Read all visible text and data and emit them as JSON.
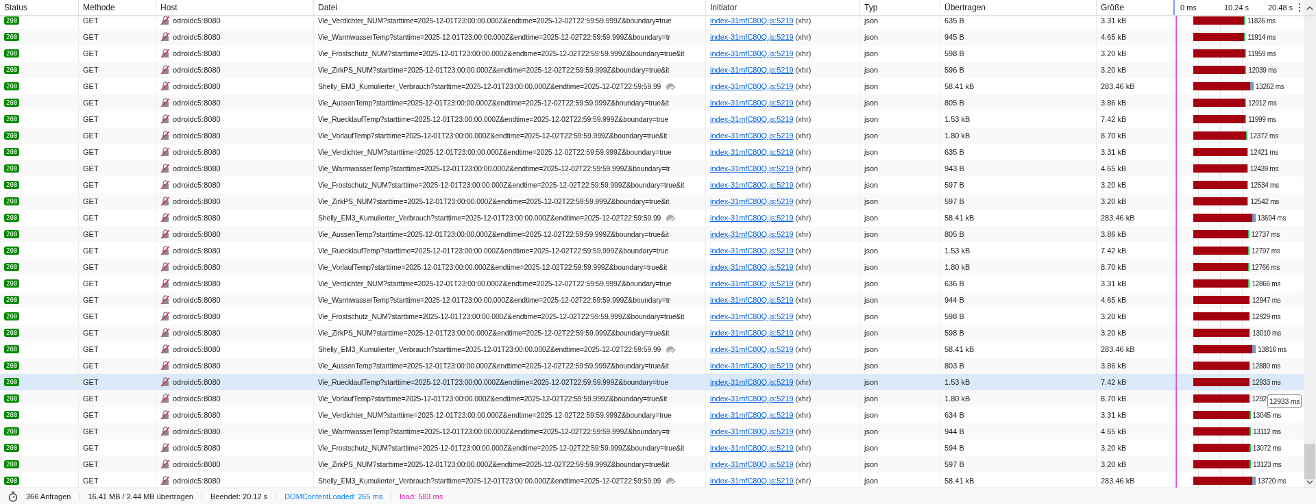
{
  "columns": [
    "Status",
    "Methode",
    "Host",
    "Datei",
    "Initiator",
    "Typ",
    "Übertragen",
    "Größe"
  ],
  "waterfall_ticks": [
    "0 ms",
    "10.24 s",
    "20.48 s"
  ],
  "rows": [
    {
      "status": "200",
      "method": "GET",
      "host": "odroidc5:8080",
      "file": "Vie_Verdichter_NUM?starttime=2025-12-01T23:00:00.000Z&endtime=2025-12-02T22:59:59.999Z&boundary=true",
      "slow": false,
      "initiator": "index-31mfC80Q.js:5219",
      "cause": "(xhr)",
      "type": "json",
      "transferred": "635 B",
      "size": "3.31 kB",
      "time": "11826 ms",
      "selected": false
    },
    {
      "status": "200",
      "method": "GET",
      "host": "odroidc5:8080",
      "file": "Vie_WarmwasserTemp?starttime=2025-12-01T23:00:00.000Z&endtime=2025-12-02T22:59:59.999Z&boundary=tr",
      "slow": false,
      "initiator": "index-31mfC80Q.js:5219",
      "cause": "(xhr)",
      "type": "json",
      "transferred": "945 B",
      "size": "4.65 kB",
      "time": "11914 ms",
      "selected": false
    },
    {
      "status": "200",
      "method": "GET",
      "host": "odroidc5:8080",
      "file": "Vie_Frostschutz_NUM?starttime=2025-12-01T23:00:00.000Z&endtime=2025-12-02T22:59:59.999Z&boundary=true&it",
      "slow": false,
      "initiator": "index-31mfC80Q.js:5219",
      "cause": "(xhr)",
      "type": "json",
      "transferred": "598 B",
      "size": "3.20 kB",
      "time": "11959 ms",
      "selected": false
    },
    {
      "status": "200",
      "method": "GET",
      "host": "odroidc5:8080",
      "file": "Vie_ZirkPS_NUM?starttime=2025-12-01T23:00:00.000Z&endtime=2025-12-02T22:59:59.999Z&boundary=true&it",
      "slow": false,
      "initiator": "index-31mfC80Q.js:5219",
      "cause": "(xhr)",
      "type": "json",
      "transferred": "596 B",
      "size": "3.20 kB",
      "time": "12039 ms",
      "selected": false
    },
    {
      "status": "200",
      "method": "GET",
      "host": "odroidc5:8080",
      "file": "Shelly_EM3_Kumulierter_Verbrauch?starttime=2025-12-01T23:00:00.000Z&endtime=2025-12-02T22:59:59.99",
      "slow": true,
      "initiator": "index-31mfC80Q.js:5219",
      "cause": "(xhr)",
      "type": "json",
      "transferred": "58.41 kB",
      "size": "283.46 kB",
      "time": "13262 ms",
      "selected": false
    },
    {
      "status": "200",
      "method": "GET",
      "host": "odroidc5:8080",
      "file": "Vie_AussenTemp?starttime=2025-12-01T23:00:00.000Z&endtime=2025-12-02T22:59:59.999Z&boundary=true&it",
      "slow": false,
      "initiator": "index-31mfC80Q.js:5219",
      "cause": "(xhr)",
      "type": "json",
      "transferred": "805 B",
      "size": "3.86 kB",
      "time": "12012 ms",
      "selected": false
    },
    {
      "status": "200",
      "method": "GET",
      "host": "odroidc5:8080",
      "file": "Vie_RuecklaufTemp?starttime=2025-12-01T23:00:00.000Z&endtime=2025-12-02T22:59:59.999Z&boundary=true",
      "slow": false,
      "initiator": "index-31mfC80Q.js:5219",
      "cause": "(xhr)",
      "type": "json",
      "transferred": "1.53 kB",
      "size": "7.42 kB",
      "time": "11999 ms",
      "selected": false
    },
    {
      "status": "200",
      "method": "GET",
      "host": "odroidc5:8080",
      "file": "Vie_VorlaufTemp?starttime=2025-12-01T23:00:00.000Z&endtime=2025-12-02T22:59:59.999Z&boundary=true&it",
      "slow": false,
      "initiator": "index-31mfC80Q.js:5219",
      "cause": "(xhr)",
      "type": "json",
      "transferred": "1.80 kB",
      "size": "8.70 kB",
      "time": "12372 ms",
      "selected": false
    },
    {
      "status": "200",
      "method": "GET",
      "host": "odroidc5:8080",
      "file": "Vie_Verdichter_NUM?starttime=2025-12-01T23:00:00.000Z&endtime=2025-12-02T22:59:59.999Z&boundary=true",
      "slow": false,
      "initiator": "index-31mfC80Q.js:5219",
      "cause": "(xhr)",
      "type": "json",
      "transferred": "635 B",
      "size": "3.31 kB",
      "time": "12421 ms",
      "selected": false
    },
    {
      "status": "200",
      "method": "GET",
      "host": "odroidc5:8080",
      "file": "Vie_WarmwasserTemp?starttime=2025-12-01T23:00:00.000Z&endtime=2025-12-02T22:59:59.999Z&boundary=tr",
      "slow": false,
      "initiator": "index-31mfC80Q.js:5219",
      "cause": "(xhr)",
      "type": "json",
      "transferred": "943 B",
      "size": "4.65 kB",
      "time": "12439 ms",
      "selected": false
    },
    {
      "status": "200",
      "method": "GET",
      "host": "odroidc5:8080",
      "file": "Vie_Frostschutz_NUM?starttime=2025-12-01T23:00:00.000Z&endtime=2025-12-02T22:59:59.999Z&boundary=true&it",
      "slow": false,
      "initiator": "index-31mfC80Q.js:5219",
      "cause": "(xhr)",
      "type": "json",
      "transferred": "597 B",
      "size": "3.20 kB",
      "time": "12534 ms",
      "selected": false
    },
    {
      "status": "200",
      "method": "GET",
      "host": "odroidc5:8080",
      "file": "Vie_ZirkPS_NUM?starttime=2025-12-01T23:00:00.000Z&endtime=2025-12-02T22:59:59.999Z&boundary=true&it",
      "slow": false,
      "initiator": "index-31mfC80Q.js:5219",
      "cause": "(xhr)",
      "type": "json",
      "transferred": "597 B",
      "size": "3.20 kB",
      "time": "12542 ms",
      "selected": false
    },
    {
      "status": "200",
      "method": "GET",
      "host": "odroidc5:8080",
      "file": "Shelly_EM3_Kumulierter_Verbrauch?starttime=2025-12-01T23:00:00.000Z&endtime=2025-12-02T22:59:59.99",
      "slow": true,
      "initiator": "index-31mfC80Q.js:5219",
      "cause": "(xhr)",
      "type": "json",
      "transferred": "58.41 kB",
      "size": "283.46 kB",
      "time": "13694 ms",
      "selected": false
    },
    {
      "status": "200",
      "method": "GET",
      "host": "odroidc5:8080",
      "file": "Vie_AussenTemp?starttime=2025-12-01T23:00:00.000Z&endtime=2025-12-02T22:59:59.999Z&boundary=true&it",
      "slow": false,
      "initiator": "index-31mfC80Q.js:5219",
      "cause": "(xhr)",
      "type": "json",
      "transferred": "805 B",
      "size": "3.86 kB",
      "time": "12737 ms",
      "selected": false
    },
    {
      "status": "200",
      "method": "GET",
      "host": "odroidc5:8080",
      "file": "Vie_RuecklaufTemp?starttime=2025-12-01T23:00:00.000Z&endtime=2025-12-02T22:59:59.999Z&boundary=true",
      "slow": false,
      "initiator": "index-31mfC80Q.js:5219",
      "cause": "(xhr)",
      "type": "json",
      "transferred": "1.53 kB",
      "size": "7.42 kB",
      "time": "12797 ms",
      "selected": false
    },
    {
      "status": "200",
      "method": "GET",
      "host": "odroidc5:8080",
      "file": "Vie_VorlaufTemp?starttime=2025-12-01T23:00:00.000Z&endtime=2025-12-02T22:59:59.999Z&boundary=true&it",
      "slow": false,
      "initiator": "index-31mfC80Q.js:5219",
      "cause": "(xhr)",
      "type": "json",
      "transferred": "1.80 kB",
      "size": "8.70 kB",
      "time": "12766 ms",
      "selected": false
    },
    {
      "status": "200",
      "method": "GET",
      "host": "odroidc5:8080",
      "file": "Vie_Verdichter_NUM?starttime=2025-12-01T23:00:00.000Z&endtime=2025-12-02T22:59:59.999Z&boundary=true",
      "slow": false,
      "initiator": "index-31mfC80Q.js:5219",
      "cause": "(xhr)",
      "type": "json",
      "transferred": "636 B",
      "size": "3.31 kB",
      "time": "12866 ms",
      "selected": false
    },
    {
      "status": "200",
      "method": "GET",
      "host": "odroidc5:8080",
      "file": "Vie_WarmwasserTemp?starttime=2025-12-01T23:00:00.000Z&endtime=2025-12-02T22:59:59.999Z&boundary=tr",
      "slow": false,
      "initiator": "index-31mfC80Q.js:5219",
      "cause": "(xhr)",
      "type": "json",
      "transferred": "944 B",
      "size": "4.65 kB",
      "time": "12947 ms",
      "selected": false
    },
    {
      "status": "200",
      "method": "GET",
      "host": "odroidc5:8080",
      "file": "Vie_Frostschutz_NUM?starttime=2025-12-01T23:00:00.000Z&endtime=2025-12-02T22:59:59.999Z&boundary=true&it",
      "slow": false,
      "initiator": "index-31mfC80Q.js:5219",
      "cause": "(xhr)",
      "type": "json",
      "transferred": "598 B",
      "size": "3.20 kB",
      "time": "12929 ms",
      "selected": false
    },
    {
      "status": "200",
      "method": "GET",
      "host": "odroidc5:8080",
      "file": "Vie_ZirkPS_NUM?starttime=2025-12-01T23:00:00.000Z&endtime=2025-12-02T22:59:59.999Z&boundary=true&it",
      "slow": false,
      "initiator": "index-31mfC80Q.js:5219",
      "cause": "(xhr)",
      "type": "json",
      "transferred": "598 B",
      "size": "3.20 kB",
      "time": "13010 ms",
      "selected": false
    },
    {
      "status": "200",
      "method": "GET",
      "host": "odroidc5:8080",
      "file": "Shelly_EM3_Kumulierter_Verbrauch?starttime=2025-12-01T23:00:00.000Z&endtime=2025-12-02T22:59:59.99",
      "slow": true,
      "initiator": "index-31mfC80Q.js:5219",
      "cause": "(xhr)",
      "type": "json",
      "transferred": "58.41 kB",
      "size": "283.46 kB",
      "time": "13816 ms",
      "selected": false
    },
    {
      "status": "200",
      "method": "GET",
      "host": "odroidc5:8080",
      "file": "Vie_AussenTemp?starttime=2025-12-01T23:00:00.000Z&endtime=2025-12-02T22:59:59.999Z&boundary=true&it",
      "slow": false,
      "initiator": "index-31mfC80Q.js:5219",
      "cause": "(xhr)",
      "type": "json",
      "transferred": "803 B",
      "size": "3.86 kB",
      "time": "12880 ms",
      "selected": false
    },
    {
      "status": "200",
      "method": "GET",
      "host": "odroidc5:8080",
      "file": "Vie_RuecklaufTemp?starttime=2025-12-01T23:00:00.000Z&endtime=2025-12-02T22:59:59.999Z&boundary=true",
      "slow": false,
      "initiator": "index-31mfC80Q.js:5219",
      "cause": "(xhr)",
      "type": "json",
      "transferred": "1.53 kB",
      "size": "7.42 kB",
      "time": "12933 ms",
      "selected": true
    },
    {
      "status": "200",
      "method": "GET",
      "host": "odroidc5:8080",
      "file": "Vie_VorlaufTemp?starttime=2025-12-01T23:00:00.000Z&endtime=2025-12-02T22:59:59.999Z&boundary=true&it",
      "slow": false,
      "initiator": "index-31mfC80Q.js:5219",
      "cause": "(xhr)",
      "type": "json",
      "transferred": "1.80 kB",
      "size": "8.70 kB",
      "time": "1292",
      "selected": false,
      "tooltip": "12933 ms"
    },
    {
      "status": "200",
      "method": "GET",
      "host": "odroidc5:8080",
      "file": "Vie_Verdichter_NUM?starttime=2025-12-01T23:00:00.000Z&endtime=2025-12-02T22:59:59.999Z&boundary=true",
      "slow": false,
      "initiator": "index-31mfC80Q.js:5219",
      "cause": "(xhr)",
      "type": "json",
      "transferred": "634 B",
      "size": "3.31 kB",
      "time": "13045 ms",
      "selected": false
    },
    {
      "status": "200",
      "method": "GET",
      "host": "odroidc5:8080",
      "file": "Vie_WarmwasserTemp?starttime=2025-12-01T23:00:00.000Z&endtime=2025-12-02T22:59:59.999Z&boundary=tr",
      "slow": false,
      "initiator": "index-31mfC80Q.js:5219",
      "cause": "(xhr)",
      "type": "json",
      "transferred": "944 B",
      "size": "4.65 kB",
      "time": "13112 ms",
      "selected": false
    },
    {
      "status": "200",
      "method": "GET",
      "host": "odroidc5:8080",
      "file": "Vie_Frostschutz_NUM?starttime=2025-12-01T23:00:00.000Z&endtime=2025-12-02T22:59:59.999Z&boundary=true&it",
      "slow": false,
      "initiator": "index-31mfC80Q.js:5219",
      "cause": "(xhr)",
      "type": "json",
      "transferred": "594 B",
      "size": "3.20 kB",
      "time": "13072 ms",
      "selected": false
    },
    {
      "status": "200",
      "method": "GET",
      "host": "odroidc5:8080",
      "file": "Vie_ZirkPS_NUM?starttime=2025-12-01T23:00:00.000Z&endtime=2025-12-02T22:59:59.999Z&boundary=true&it",
      "slow": false,
      "initiator": "index-31mfC80Q.js:5219",
      "cause": "(xhr)",
      "type": "json",
      "transferred": "597 B",
      "size": "3.20 kB",
      "time": "13123 ms",
      "selected": false
    },
    {
      "status": "200",
      "method": "GET",
      "host": "odroidc5:8080",
      "file": "Shelly_EM3_Kumulierter_Verbrauch?starttime=2025-12-01T23:00:00.000Z&endtime=2025-12-02T22:59:59.99",
      "slow": true,
      "initiator": "index-31mfC80Q.js:5219",
      "cause": "(xhr)",
      "type": "json",
      "transferred": "58.41 kB",
      "size": "283.46 kB",
      "time": "13720 ms",
      "selected": false
    }
  ],
  "status_bar": {
    "requests": "366 Anfragen",
    "transferred": "16.41 MB / 2.44 MB übertragen",
    "finished": "Beendet: 20.12 s",
    "dom_content_loaded": "DOMContentLoaded: 265 ms",
    "load": "load: 583 ms"
  }
}
